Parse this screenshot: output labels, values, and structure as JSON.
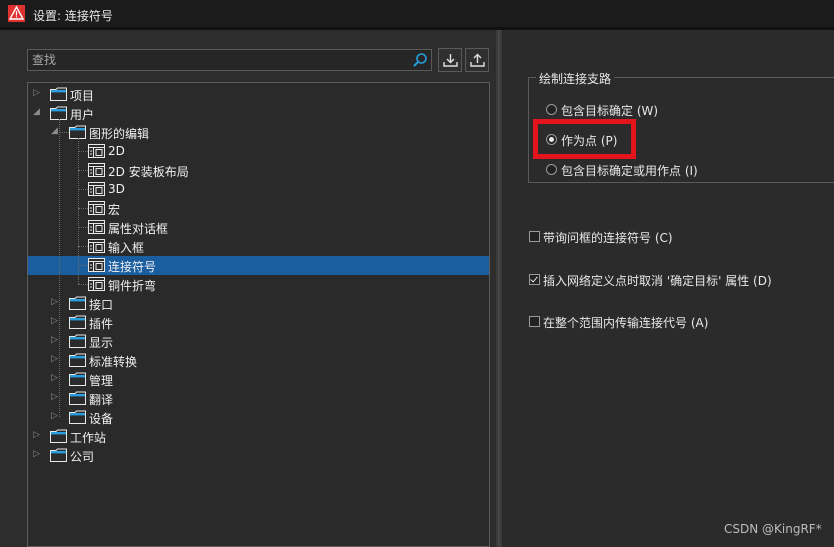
{
  "window": {
    "title": "设置: 连接符号"
  },
  "search": {
    "placeholder": "查找"
  },
  "toolbar": {
    "import_icon": "import-icon",
    "export_icon": "export-icon"
  },
  "tree": {
    "items": [
      {
        "label": "项目",
        "level": 0,
        "icon": "folder",
        "expander": "collapsed"
      },
      {
        "label": "用户",
        "level": 0,
        "icon": "folder",
        "expander": "expanded"
      },
      {
        "label": "图形的编辑",
        "level": 1,
        "icon": "folder",
        "expander": "expanded"
      },
      {
        "label": "2D",
        "level": 2,
        "icon": "page",
        "expander": "none"
      },
      {
        "label": "2D 安装板布局",
        "level": 2,
        "icon": "page",
        "expander": "none"
      },
      {
        "label": "3D",
        "level": 2,
        "icon": "page",
        "expander": "none"
      },
      {
        "label": "宏",
        "level": 2,
        "icon": "page",
        "expander": "none"
      },
      {
        "label": "属性对话框",
        "level": 2,
        "icon": "page",
        "expander": "none"
      },
      {
        "label": "输入框",
        "level": 2,
        "icon": "page",
        "expander": "none"
      },
      {
        "label": "连接符号",
        "level": 2,
        "icon": "page",
        "expander": "none",
        "selected": true
      },
      {
        "label": "铜件折弯",
        "level": 2,
        "icon": "page",
        "expander": "none"
      },
      {
        "label": "接口",
        "level": 1,
        "icon": "folder",
        "expander": "collapsed"
      },
      {
        "label": "插件",
        "level": 1,
        "icon": "folder",
        "expander": "collapsed"
      },
      {
        "label": "显示",
        "level": 1,
        "icon": "folder",
        "expander": "collapsed"
      },
      {
        "label": "标准转换",
        "level": 1,
        "icon": "folder",
        "expander": "collapsed"
      },
      {
        "label": "管理",
        "level": 1,
        "icon": "folder",
        "expander": "collapsed"
      },
      {
        "label": "翻译",
        "level": 1,
        "icon": "folder",
        "expander": "collapsed"
      },
      {
        "label": "设备",
        "level": 1,
        "icon": "folder",
        "expander": "collapsed"
      },
      {
        "label": "工作站",
        "level": 0,
        "icon": "folder",
        "expander": "collapsed"
      },
      {
        "label": "公司",
        "level": 0,
        "icon": "folder",
        "expander": "collapsed"
      }
    ]
  },
  "settings": {
    "group_title": "绘制连接支路",
    "radios": [
      {
        "label": "包含目标确定 (W)",
        "checked": false
      },
      {
        "label": "作为点 (P)",
        "checked": true
      },
      {
        "label": "包含目标确定或用作点 (I)",
        "checked": false
      }
    ],
    "checkboxes": [
      {
        "label": "带询问框的连接符号 (C)",
        "checked": false
      },
      {
        "label": "插入网络定义点时取消 '确定目标' 属性 (D)",
        "checked": true
      },
      {
        "label": "在整个范围内传输连接代号 (A)",
        "checked": false
      }
    ]
  },
  "colors": {
    "selection": "#1b5ea0",
    "highlight": "#e3141c",
    "folder": "#2a9fe0"
  },
  "watermark": "CSDN @KingRF*"
}
